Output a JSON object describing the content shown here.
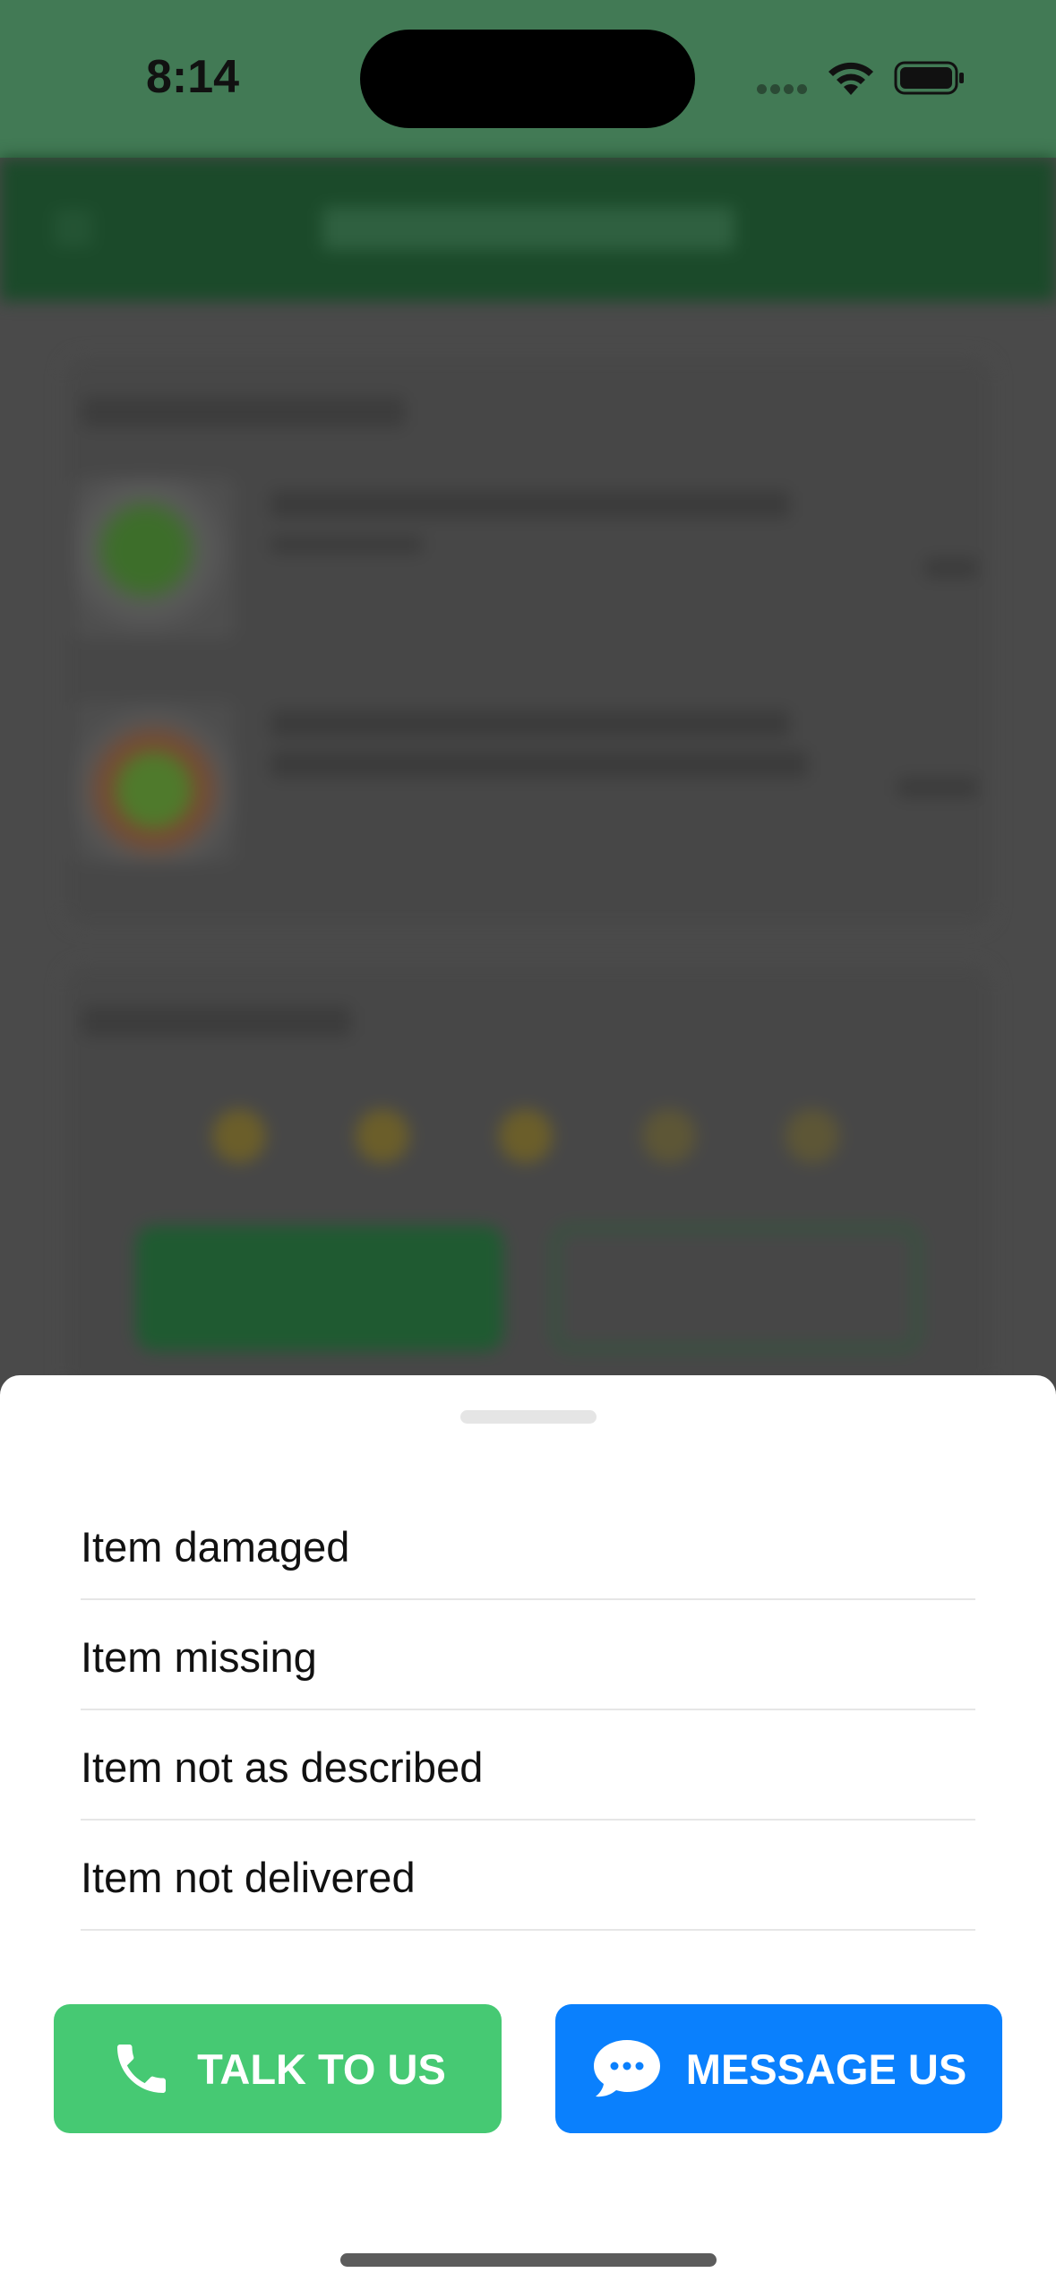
{
  "status_bar": {
    "time": "8:14",
    "signal_icon": "cellular-signal-icon",
    "wifi_icon": "wifi-icon",
    "battery_icon": "battery-icon"
  },
  "sheet": {
    "options": [
      {
        "label": "Item damaged"
      },
      {
        "label": "Item missing"
      },
      {
        "label": "Item not as described"
      },
      {
        "label": "Item not delivered"
      }
    ],
    "talk_button": {
      "label": "TALK TO US",
      "icon": "phone-icon",
      "color": "#46c973"
    },
    "message_button": {
      "label": "MESSAGE US",
      "icon": "chat-bubble-icon",
      "color": "#0a80fd"
    }
  }
}
